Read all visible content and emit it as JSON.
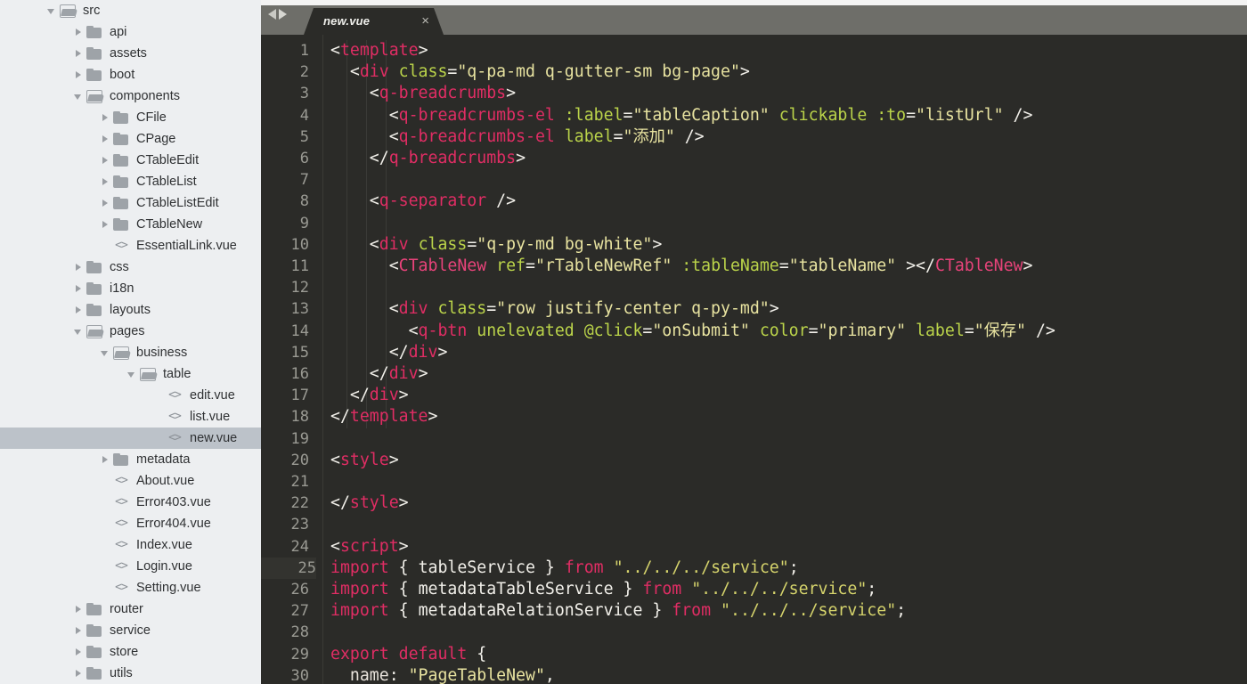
{
  "sidebar": {
    "items": [
      {
        "label": "src",
        "depth": 0,
        "kind": "folder-open",
        "twisty": "open",
        "selected": false
      },
      {
        "label": "api",
        "depth": 1,
        "kind": "folder",
        "twisty": "closed",
        "selected": false
      },
      {
        "label": "assets",
        "depth": 1,
        "kind": "folder",
        "twisty": "closed",
        "selected": false
      },
      {
        "label": "boot",
        "depth": 1,
        "kind": "folder",
        "twisty": "closed",
        "selected": false
      },
      {
        "label": "components",
        "depth": 1,
        "kind": "folder-open",
        "twisty": "open",
        "selected": false
      },
      {
        "label": "CFile",
        "depth": 2,
        "kind": "folder",
        "twisty": "closed",
        "selected": false
      },
      {
        "label": "CPage",
        "depth": 2,
        "kind": "folder",
        "twisty": "closed",
        "selected": false
      },
      {
        "label": "CTableEdit",
        "depth": 2,
        "kind": "folder",
        "twisty": "closed",
        "selected": false
      },
      {
        "label": "CTableList",
        "depth": 2,
        "kind": "folder",
        "twisty": "closed",
        "selected": false
      },
      {
        "label": "CTableListEdit",
        "depth": 2,
        "kind": "folder",
        "twisty": "closed",
        "selected": false
      },
      {
        "label": "CTableNew",
        "depth": 2,
        "kind": "folder",
        "twisty": "closed",
        "selected": false
      },
      {
        "label": "EssentialLink.vue",
        "depth": 2,
        "kind": "code",
        "twisty": "none",
        "selected": false
      },
      {
        "label": "css",
        "depth": 1,
        "kind": "folder",
        "twisty": "closed",
        "selected": false
      },
      {
        "label": "i18n",
        "depth": 1,
        "kind": "folder",
        "twisty": "closed",
        "selected": false
      },
      {
        "label": "layouts",
        "depth": 1,
        "kind": "folder",
        "twisty": "closed",
        "selected": false
      },
      {
        "label": "pages",
        "depth": 1,
        "kind": "folder-open",
        "twisty": "open",
        "selected": false
      },
      {
        "label": "business",
        "depth": 2,
        "kind": "folder-open",
        "twisty": "open",
        "selected": false
      },
      {
        "label": "table",
        "depth": 3,
        "kind": "folder-open",
        "twisty": "open",
        "selected": false
      },
      {
        "label": "edit.vue",
        "depth": 4,
        "kind": "code",
        "twisty": "none",
        "selected": false
      },
      {
        "label": "list.vue",
        "depth": 4,
        "kind": "code",
        "twisty": "none",
        "selected": false
      },
      {
        "label": "new.vue",
        "depth": 4,
        "kind": "code",
        "twisty": "none",
        "selected": true
      },
      {
        "label": "metadata",
        "depth": 2,
        "kind": "folder",
        "twisty": "closed",
        "selected": false
      },
      {
        "label": "About.vue",
        "depth": 2,
        "kind": "code",
        "twisty": "none",
        "selected": false
      },
      {
        "label": "Error403.vue",
        "depth": 2,
        "kind": "code",
        "twisty": "none",
        "selected": false
      },
      {
        "label": "Error404.vue",
        "depth": 2,
        "kind": "code",
        "twisty": "none",
        "selected": false
      },
      {
        "label": "Index.vue",
        "depth": 2,
        "kind": "code",
        "twisty": "none",
        "selected": false
      },
      {
        "label": "Login.vue",
        "depth": 2,
        "kind": "code",
        "twisty": "none",
        "selected": false
      },
      {
        "label": "Setting.vue",
        "depth": 2,
        "kind": "code",
        "twisty": "none",
        "selected": false
      },
      {
        "label": "router",
        "depth": 1,
        "kind": "folder",
        "twisty": "closed",
        "selected": false
      },
      {
        "label": "service",
        "depth": 1,
        "kind": "folder",
        "twisty": "closed",
        "selected": false
      },
      {
        "label": "store",
        "depth": 1,
        "kind": "folder",
        "twisty": "closed",
        "selected": false
      },
      {
        "label": "utils",
        "depth": 1,
        "kind": "folder",
        "twisty": "closed",
        "selected": false
      }
    ]
  },
  "editor": {
    "tab": {
      "title": "new.vue",
      "close_label": "×"
    },
    "nav": {
      "back_icon": "arrow-left-icon",
      "forward_icon": "arrow-right-icon"
    },
    "active_line": 25,
    "colors": {
      "background": "#2b2b28",
      "tabbar": "#6e6e69",
      "tag": "#e02d64",
      "attribute": "#bbd44a",
      "string": "#e8e3a0",
      "plain": "#f2f0ea",
      "line_number": "#9a9a93",
      "sidebar_background": "#edeff1",
      "sidebar_selected": "#bcc2c9"
    },
    "lines": [
      {
        "n": 1,
        "indent": 0,
        "tokens": [
          {
            "t": "punc",
            "v": "<"
          },
          {
            "t": "tag",
            "v": "template"
          },
          {
            "t": "punc",
            "v": ">"
          }
        ]
      },
      {
        "n": 2,
        "indent": 1,
        "tokens": [
          {
            "t": "punc",
            "v": "<"
          },
          {
            "t": "tag",
            "v": "div"
          },
          {
            "t": "plain",
            "v": " "
          },
          {
            "t": "attr",
            "v": "class"
          },
          {
            "t": "punc",
            "v": "="
          },
          {
            "t": "str",
            "v": "\"q-pa-md q-gutter-sm bg-page\""
          },
          {
            "t": "punc",
            "v": ">"
          }
        ]
      },
      {
        "n": 3,
        "indent": 2,
        "tokens": [
          {
            "t": "punc",
            "v": "<"
          },
          {
            "t": "tag",
            "v": "q-breadcrumbs"
          },
          {
            "t": "punc",
            "v": ">"
          }
        ]
      },
      {
        "n": 4,
        "indent": 3,
        "tokens": [
          {
            "t": "punc",
            "v": "<"
          },
          {
            "t": "tag",
            "v": "q-breadcrumbs-el"
          },
          {
            "t": "plain",
            "v": " "
          },
          {
            "t": "attr",
            "v": ":label"
          },
          {
            "t": "punc",
            "v": "="
          },
          {
            "t": "str",
            "v": "\"tableCaption\""
          },
          {
            "t": "plain",
            "v": " "
          },
          {
            "t": "attr",
            "v": "clickable"
          },
          {
            "t": "plain",
            "v": " "
          },
          {
            "t": "attr",
            "v": ":to"
          },
          {
            "t": "punc",
            "v": "="
          },
          {
            "t": "str",
            "v": "\"listUrl\""
          },
          {
            "t": "punc",
            "v": " />"
          }
        ]
      },
      {
        "n": 5,
        "indent": 3,
        "tokens": [
          {
            "t": "punc",
            "v": "<"
          },
          {
            "t": "tag",
            "v": "q-breadcrumbs-el"
          },
          {
            "t": "plain",
            "v": " "
          },
          {
            "t": "attr",
            "v": "label"
          },
          {
            "t": "punc",
            "v": "="
          },
          {
            "t": "str",
            "v": "\"添加\""
          },
          {
            "t": "punc",
            "v": " />"
          }
        ]
      },
      {
        "n": 6,
        "indent": 2,
        "tokens": [
          {
            "t": "punc",
            "v": "</"
          },
          {
            "t": "tag",
            "v": "q-breadcrumbs"
          },
          {
            "t": "punc",
            "v": ">"
          }
        ]
      },
      {
        "n": 7,
        "indent": 0,
        "tokens": []
      },
      {
        "n": 8,
        "indent": 2,
        "tokens": [
          {
            "t": "punc",
            "v": "<"
          },
          {
            "t": "tag",
            "v": "q-separator"
          },
          {
            "t": "punc",
            "v": " />"
          }
        ]
      },
      {
        "n": 9,
        "indent": 0,
        "tokens": []
      },
      {
        "n": 10,
        "indent": 2,
        "tokens": [
          {
            "t": "punc",
            "v": "<"
          },
          {
            "t": "tag",
            "v": "div"
          },
          {
            "t": "plain",
            "v": " "
          },
          {
            "t": "attr",
            "v": "class"
          },
          {
            "t": "punc",
            "v": "="
          },
          {
            "t": "str",
            "v": "\"q-py-md bg-white\""
          },
          {
            "t": "punc",
            "v": ">"
          }
        ]
      },
      {
        "n": 11,
        "indent": 3,
        "tokens": [
          {
            "t": "punc",
            "v": "<"
          },
          {
            "t": "comp",
            "v": "CTableNew"
          },
          {
            "t": "plain",
            "v": " "
          },
          {
            "t": "attr",
            "v": "ref"
          },
          {
            "t": "punc",
            "v": "="
          },
          {
            "t": "str",
            "v": "\"rTableNewRef\""
          },
          {
            "t": "plain",
            "v": " "
          },
          {
            "t": "attr",
            "v": ":tableName"
          },
          {
            "t": "punc",
            "v": "="
          },
          {
            "t": "str",
            "v": "\"tableName\""
          },
          {
            "t": "punc",
            "v": " ></"
          },
          {
            "t": "comp",
            "v": "CTableNew"
          },
          {
            "t": "punc",
            "v": ">"
          }
        ]
      },
      {
        "n": 12,
        "indent": 0,
        "tokens": []
      },
      {
        "n": 13,
        "indent": 3,
        "tokens": [
          {
            "t": "punc",
            "v": "<"
          },
          {
            "t": "tag",
            "v": "div"
          },
          {
            "t": "plain",
            "v": " "
          },
          {
            "t": "attr",
            "v": "class"
          },
          {
            "t": "punc",
            "v": "="
          },
          {
            "t": "str",
            "v": "\"row justify-center q-py-md\""
          },
          {
            "t": "punc",
            "v": ">"
          }
        ]
      },
      {
        "n": 14,
        "indent": 4,
        "tokens": [
          {
            "t": "punc",
            "v": "<"
          },
          {
            "t": "tag",
            "v": "q-btn"
          },
          {
            "t": "plain",
            "v": " "
          },
          {
            "t": "attr",
            "v": "unelevated"
          },
          {
            "t": "plain",
            "v": " "
          },
          {
            "t": "attr",
            "v": "@click"
          },
          {
            "t": "punc",
            "v": "="
          },
          {
            "t": "str",
            "v": "\"onSubmit\""
          },
          {
            "t": "plain",
            "v": " "
          },
          {
            "t": "attr",
            "v": "color"
          },
          {
            "t": "punc",
            "v": "="
          },
          {
            "t": "str",
            "v": "\"primary\""
          },
          {
            "t": "plain",
            "v": " "
          },
          {
            "t": "attr",
            "v": "label"
          },
          {
            "t": "punc",
            "v": "="
          },
          {
            "t": "str",
            "v": "\"保存\""
          },
          {
            "t": "punc",
            "v": " />"
          }
        ]
      },
      {
        "n": 15,
        "indent": 3,
        "tokens": [
          {
            "t": "punc",
            "v": "</"
          },
          {
            "t": "tag",
            "v": "div"
          },
          {
            "t": "punc",
            "v": ">"
          }
        ]
      },
      {
        "n": 16,
        "indent": 2,
        "tokens": [
          {
            "t": "punc",
            "v": "</"
          },
          {
            "t": "tag",
            "v": "div"
          },
          {
            "t": "punc",
            "v": ">"
          }
        ]
      },
      {
        "n": 17,
        "indent": 1,
        "tokens": [
          {
            "t": "punc",
            "v": "</"
          },
          {
            "t": "tag",
            "v": "div"
          },
          {
            "t": "punc",
            "v": ">"
          }
        ]
      },
      {
        "n": 18,
        "indent": 0,
        "tokens": [
          {
            "t": "punc",
            "v": "</"
          },
          {
            "t": "tag",
            "v": "template"
          },
          {
            "t": "punc",
            "v": ">"
          }
        ]
      },
      {
        "n": 19,
        "indent": 0,
        "tokens": []
      },
      {
        "n": 20,
        "indent": 0,
        "tokens": [
          {
            "t": "punc",
            "v": "<"
          },
          {
            "t": "tag",
            "v": "style"
          },
          {
            "t": "punc",
            "v": ">"
          }
        ]
      },
      {
        "n": 21,
        "indent": 0,
        "tokens": []
      },
      {
        "n": 22,
        "indent": 0,
        "tokens": [
          {
            "t": "punc",
            "v": "</"
          },
          {
            "t": "tag",
            "v": "style"
          },
          {
            "t": "punc",
            "v": ">"
          }
        ]
      },
      {
        "n": 23,
        "indent": 0,
        "tokens": []
      },
      {
        "n": 24,
        "indent": 0,
        "tokens": [
          {
            "t": "punc",
            "v": "<"
          },
          {
            "t": "tag",
            "v": "script"
          },
          {
            "t": "punc",
            "v": ">"
          }
        ]
      },
      {
        "n": 25,
        "indent": 0,
        "tokens": [
          {
            "t": "kw",
            "v": "import"
          },
          {
            "t": "plain",
            "v": " { "
          },
          {
            "t": "plain",
            "v": "tableService"
          },
          {
            "t": "plain",
            "v": " } "
          },
          {
            "t": "kw",
            "v": "from"
          },
          {
            "t": "plain",
            "v": " "
          },
          {
            "t": "str2",
            "v": "\"../../../service\""
          },
          {
            "t": "plain",
            "v": ";"
          }
        ]
      },
      {
        "n": 26,
        "indent": 0,
        "tokens": [
          {
            "t": "kw",
            "v": "import"
          },
          {
            "t": "plain",
            "v": " { "
          },
          {
            "t": "plain",
            "v": "metadataTableService"
          },
          {
            "t": "plain",
            "v": " } "
          },
          {
            "t": "kw",
            "v": "from"
          },
          {
            "t": "plain",
            "v": " "
          },
          {
            "t": "str2",
            "v": "\"../../../service\""
          },
          {
            "t": "plain",
            "v": ";"
          }
        ]
      },
      {
        "n": 27,
        "indent": 0,
        "tokens": [
          {
            "t": "kw",
            "v": "import"
          },
          {
            "t": "plain",
            "v": " { "
          },
          {
            "t": "plain",
            "v": "metadataRelationService"
          },
          {
            "t": "plain",
            "v": " } "
          },
          {
            "t": "kw",
            "v": "from"
          },
          {
            "t": "plain",
            "v": " "
          },
          {
            "t": "str2",
            "v": "\"../../../service\""
          },
          {
            "t": "plain",
            "v": ";"
          }
        ]
      },
      {
        "n": 28,
        "indent": 0,
        "tokens": []
      },
      {
        "n": 29,
        "indent": 0,
        "tokens": [
          {
            "t": "kw",
            "v": "export"
          },
          {
            "t": "plain",
            "v": " "
          },
          {
            "t": "kw",
            "v": "default"
          },
          {
            "t": "plain",
            "v": " {"
          }
        ]
      },
      {
        "n": 30,
        "indent": 1,
        "tokens": [
          {
            "t": "prop",
            "v": "name"
          },
          {
            "t": "plain",
            "v": ": "
          },
          {
            "t": "str",
            "v": "\"PageTableNew\""
          },
          {
            "t": "plain",
            "v": ","
          }
        ]
      }
    ]
  }
}
